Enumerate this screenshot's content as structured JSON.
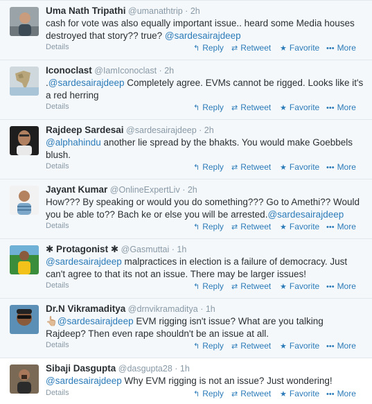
{
  "footer_actions": {
    "details": "Details",
    "reply": "Reply",
    "retweet": "Retweet",
    "favorite": "Favorite",
    "more": "More"
  },
  "icons": {
    "reply": "reply-arrow-icon",
    "retweet": "retweet-arrows-icon",
    "favorite": "star-icon",
    "more": "ellipsis-icon"
  },
  "colors": {
    "link": "#2b7bb9",
    "muted": "#8899a6",
    "text": "#292f33",
    "background": "#f5f8fa"
  },
  "tweets": [
    {
      "fullname": "Uma Nath Tripathi",
      "username": "@umanathtrip",
      "time": "2h",
      "segments": [
        {
          "t": "cash for vote was also equally important issue.. heard some Media houses destroyed that story?? true? "
        },
        {
          "t": "@sardesairajdeep",
          "m": true
        }
      ]
    },
    {
      "fullname": "Iconoclast",
      "username": "@IamIconoclast",
      "time": "2h",
      "segments": [
        {
          "t": "."
        },
        {
          "t": "@sardesairajdeep",
          "m": true
        },
        {
          "t": " Completely agree. EVMs cannot be rigged. Looks like it's a red herring"
        }
      ]
    },
    {
      "fullname": "Rajdeep Sardesai",
      "username": "@sardesairajdeep",
      "time": "2h",
      "segments": [
        {
          "t": "@alphahindu",
          "m": true
        },
        {
          "t": " another lie spread by the bhakts. You would make Goebbels blush."
        }
      ]
    },
    {
      "fullname": "Jayant Kumar",
      "username": "@OnlineExpertLiv",
      "time": "2h",
      "segments": [
        {
          "t": "How??? By speaking or would you do something??? Go to Amethi?? Would you be able to?? Bach ke or else you will be arrested."
        },
        {
          "t": "@sardesairajdeep",
          "m": true
        }
      ]
    },
    {
      "fullname": "✱ Protagonist ✱",
      "username": "@Gasmuttai",
      "time": "1h",
      "segments": [
        {
          "t": "@sardesairajdeep",
          "m": true
        },
        {
          "t": " malpractices in election is a failure of democracy. Just can't agree to that its not an issue. There may be larger issues!"
        }
      ]
    },
    {
      "fullname": "Dr.N Vikramaditya",
      "username": "@drnvikramaditya",
      "time": "1h",
      "segments": [
        {
          "t": "👆🏼"
        },
        {
          "t": "@sardesairajdeep",
          "m": true
        },
        {
          "t": " EVM rigging isn't issue? What are you talking Rajdeep? Then even rape shouldn't be an issue at all."
        }
      ]
    },
    {
      "fullname": "Sibaji Dasgupta",
      "username": "@dasgupta28",
      "time": "1h",
      "segments": [
        {
          "t": "@sardesairajdeep",
          "m": true
        },
        {
          "t": " Why EVM rigging is not an issue? Just wondering!"
        }
      ]
    }
  ]
}
